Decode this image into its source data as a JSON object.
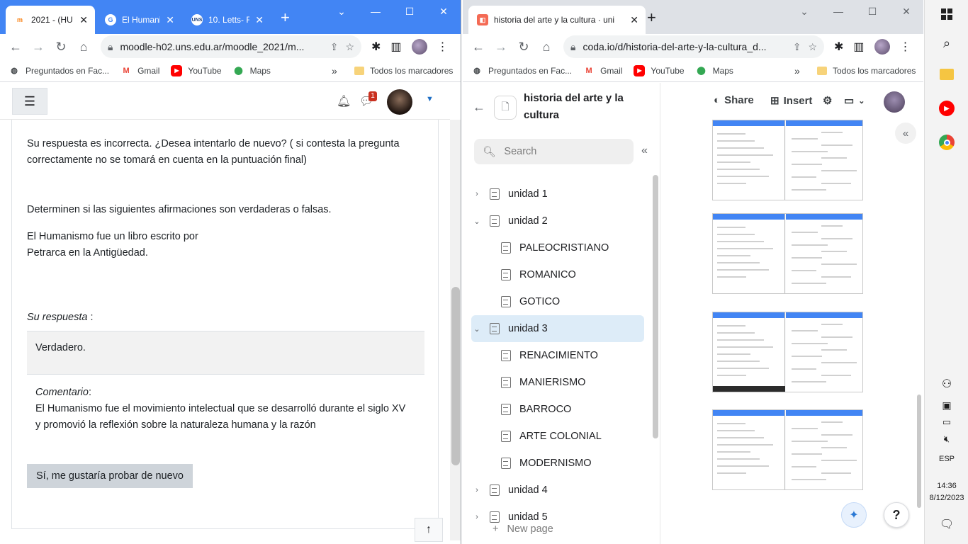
{
  "left_browser": {
    "tabs": [
      {
        "title": "2021 - (HU",
        "favicon": "moodle-icon",
        "color": "#f98012"
      },
      {
        "title": "El Humani",
        "favicon": "google-icon",
        "color": "#4285f4"
      },
      {
        "title": "10. Letts- R",
        "favicon": "uns-icon",
        "color": "#1a3c7a"
      }
    ],
    "url": "moodle-h02.uns.edu.ar/moodle_2021/m...",
    "bookmarks": [
      {
        "label": "Preguntados en Fac...",
        "icon": "globe-icon"
      },
      {
        "label": "Gmail",
        "icon": "gmail-icon"
      },
      {
        "label": "YouTube",
        "icon": "youtube-icon"
      },
      {
        "label": "Maps",
        "icon": "maps-icon"
      }
    ],
    "bookmarks_more": "»",
    "all_bookmarks": "Todos los marcadores"
  },
  "moodle": {
    "notification_count": "1",
    "feedback_line1": "Su respuesta es incorrecta. ¿Desea intentarlo de nuevo? ( si contesta la pregunta",
    "feedback_line2": "correctamente no se tomará en cuenta en la puntuación final)",
    "instruction": "Determinen si las siguientes afirmaciones son verdaderas o falsas.",
    "statement_line1": "El Humanismo fue un libro escrito por",
    "statement_line2": "Petrarca en la Antigüedad.",
    "your_answer_label": "Su respuesta",
    "your_answer_colon": " :",
    "answer_value": "Verdadero.",
    "comment_label": "Comentario",
    "comment_colon": ":",
    "comment_line1": "El Humanismo fue el movimiento intelectual que se desarrolló durante el siglo XV",
    "comment_line2": "y promovió la reflexión sobre la naturaleza humana y la razón",
    "retry_button": "Sí, me gustaría probar de nuevo"
  },
  "right_browser": {
    "tab_title": "historia del arte y la cultura · uni",
    "url": "coda.io/d/historia-del-arte-y-la-cultura_d...",
    "bookmarks": [
      {
        "label": "Preguntados en Fac...",
        "icon": "globe-icon"
      },
      {
        "label": "Gmail",
        "icon": "gmail-icon"
      },
      {
        "label": "YouTube",
        "icon": "youtube-icon"
      },
      {
        "label": "Maps",
        "icon": "maps-icon"
      }
    ],
    "bookmarks_more": "»",
    "all_bookmarks": "Todos los marcadores"
  },
  "coda": {
    "doc_title": "historia del arte y la cultura",
    "search_placeholder": "Search",
    "toolbar": {
      "share": "Share",
      "insert": "Insert"
    },
    "tree": [
      {
        "label": "unidad 1",
        "level": 0,
        "chevron": "›",
        "selected": false
      },
      {
        "label": "unidad 2",
        "level": 0,
        "chevron": "⌄",
        "selected": false
      },
      {
        "label": "PALEOCRISTIANO",
        "level": 1,
        "chevron": "",
        "selected": false
      },
      {
        "label": "ROMANICO",
        "level": 1,
        "chevron": "",
        "selected": false
      },
      {
        "label": "GOTICO",
        "level": 1,
        "chevron": "",
        "selected": false
      },
      {
        "label": "unidad 3",
        "level": 0,
        "chevron": "⌄",
        "selected": true
      },
      {
        "label": "RENACIMIENTO",
        "level": 1,
        "chevron": "",
        "selected": false
      },
      {
        "label": "MANIERISMO",
        "level": 1,
        "chevron": "",
        "selected": false
      },
      {
        "label": "BARROCO",
        "level": 1,
        "chevron": "",
        "selected": false
      },
      {
        "label": "ARTE COLONIAL",
        "level": 1,
        "chevron": "",
        "selected": false
      },
      {
        "label": "MODERNISMO",
        "level": 1,
        "chevron": "",
        "selected": false
      },
      {
        "label": "unidad 4",
        "level": 0,
        "chevron": "›",
        "selected": false
      },
      {
        "label": "unidad 5",
        "level": 0,
        "chevron": "›",
        "selected": false
      }
    ],
    "new_page": "New page",
    "screenshot_count": 4
  },
  "taskbar": {
    "language": "ESP",
    "time": "14:36",
    "date": "8/12/2023"
  }
}
